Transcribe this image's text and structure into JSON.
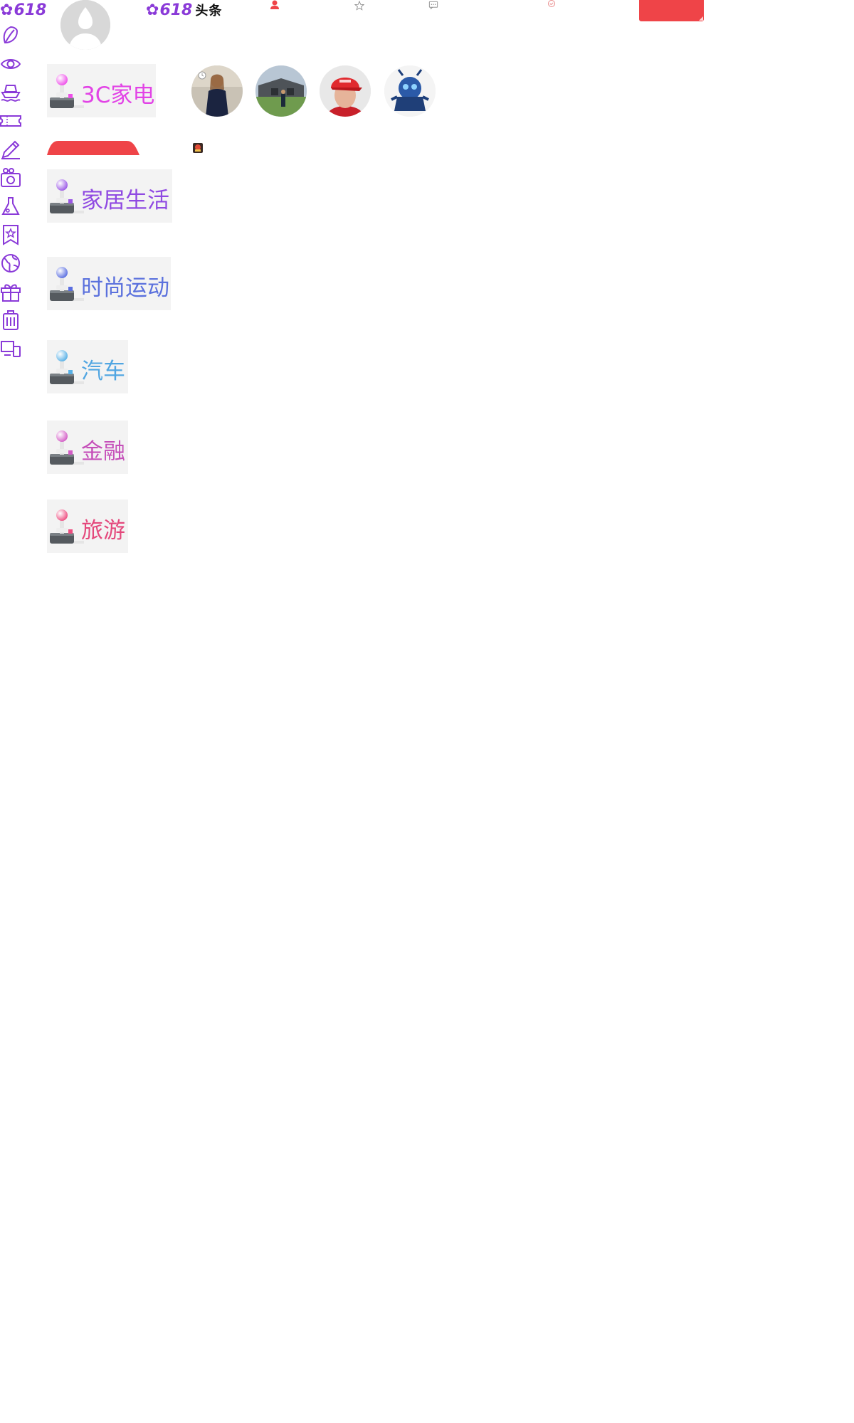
{
  "brand": {
    "logo_left": "618",
    "logo_center_number": "618",
    "logo_center_suffix": "头条",
    "accent_color": "#8a3ad8",
    "primary_red": "#ef4448"
  },
  "top_nav": {
    "icons": [
      "user-icon",
      "star-icon",
      "message-icon",
      "circle-check-icon"
    ]
  },
  "sidebar": {
    "icons": [
      "leaf-icon",
      "eye-icon",
      "ship-icon",
      "ticket-icon",
      "pencil-icon",
      "camera-icon",
      "flask-icon",
      "bookmark-star-icon",
      "globe-icon",
      "gift-icon",
      "luggage-icon",
      "devices-icon"
    ]
  },
  "categories": [
    {
      "label": "3C家电",
      "color": "#e243e6",
      "knob": "#ee4ee9"
    },
    {
      "label": "家居生活",
      "color": "#8f49e2",
      "knob": "#9b57e6"
    },
    {
      "label": "时尚运动",
      "color": "#5b71dd",
      "knob": "#5a6ee0"
    },
    {
      "label": "汽车",
      "color": "#51a6e2",
      "knob": "#57b0e6"
    },
    {
      "label": "金融",
      "color": "#c54fb9",
      "knob": "#d35cc6"
    },
    {
      "label": "旅游",
      "color": "#e4487c",
      "knob": "#ee4d80"
    }
  ]
}
